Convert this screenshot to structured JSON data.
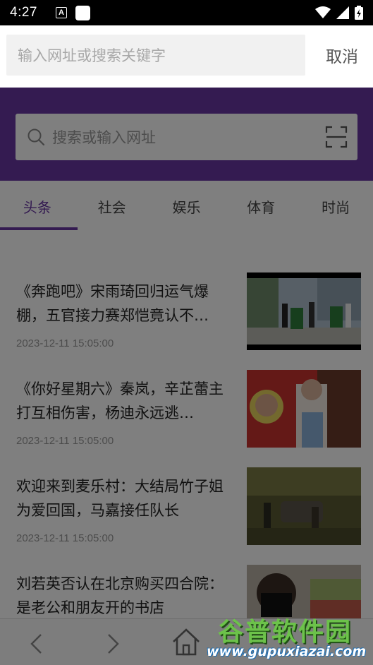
{
  "status_bar": {
    "time": "4:27",
    "notification_letter": "A"
  },
  "search_overlay": {
    "placeholder": "输入网址或搜索关键字",
    "cancel_label": "取消"
  },
  "page": {
    "search_placeholder": "搜索或输入网址",
    "accent_color": "#6936a3",
    "tabs": [
      {
        "label": "头条",
        "active": true
      },
      {
        "label": "社会"
      },
      {
        "label": "娱乐"
      },
      {
        "label": "体育"
      },
      {
        "label": "时尚"
      }
    ],
    "news": [
      {
        "title": "《奔跑吧》宋雨琦回归运气爆棚，五官接力赛郑恺竟认不…",
        "time": "2023-12-11 15:05:00"
      },
      {
        "title": "《你好星期六》秦岚，辛芷蕾主打互相伤害，杨迪永远逃…",
        "time": "2023-12-11 15:05:00"
      },
      {
        "title": "欢迎来到麦乐村：大结局竹子姐为爱回国，马嘉接任队长",
        "time": "2023-12-11 15:05:00"
      },
      {
        "title": "刘若英否认在北京购买四合院：是老公和朋友开的书店",
        "time": ""
      }
    ],
    "bottom_nav": {
      "back_icon": "chevron-left-icon",
      "forward_icon": "chevron-right-icon",
      "home_icon": "home-icon"
    }
  },
  "watermark": {
    "title": "谷普软件园",
    "url": "www.gupuxiazai.com"
  }
}
